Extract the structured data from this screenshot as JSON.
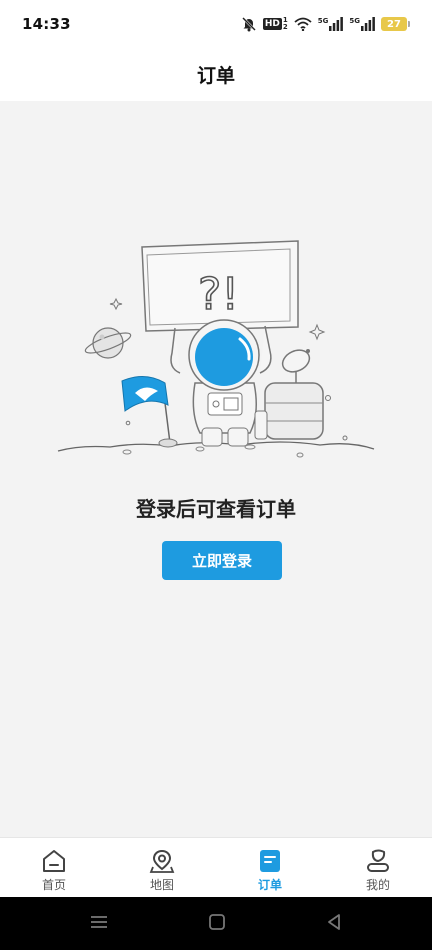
{
  "status_bar": {
    "time": "14:33",
    "hd_label": "HD",
    "network_1": "5G",
    "network_2": "5G",
    "battery_level": "27"
  },
  "header": {
    "title": "订单"
  },
  "empty_state": {
    "message": "登录后可查看订单",
    "button_label": "立即登录",
    "sign_text": "?!"
  },
  "tabbar": {
    "active_tab": "订单",
    "items": [
      {
        "label": "首页",
        "icon": "home-icon"
      },
      {
        "label": "地图",
        "icon": "map-pin-icon"
      },
      {
        "label": "订单",
        "icon": "order-icon"
      },
      {
        "label": "我的",
        "icon": "profile-icon"
      }
    ]
  },
  "colors": {
    "accent": "#1e9be0",
    "background": "#f3f3f3",
    "battery": "#e8c84a"
  }
}
